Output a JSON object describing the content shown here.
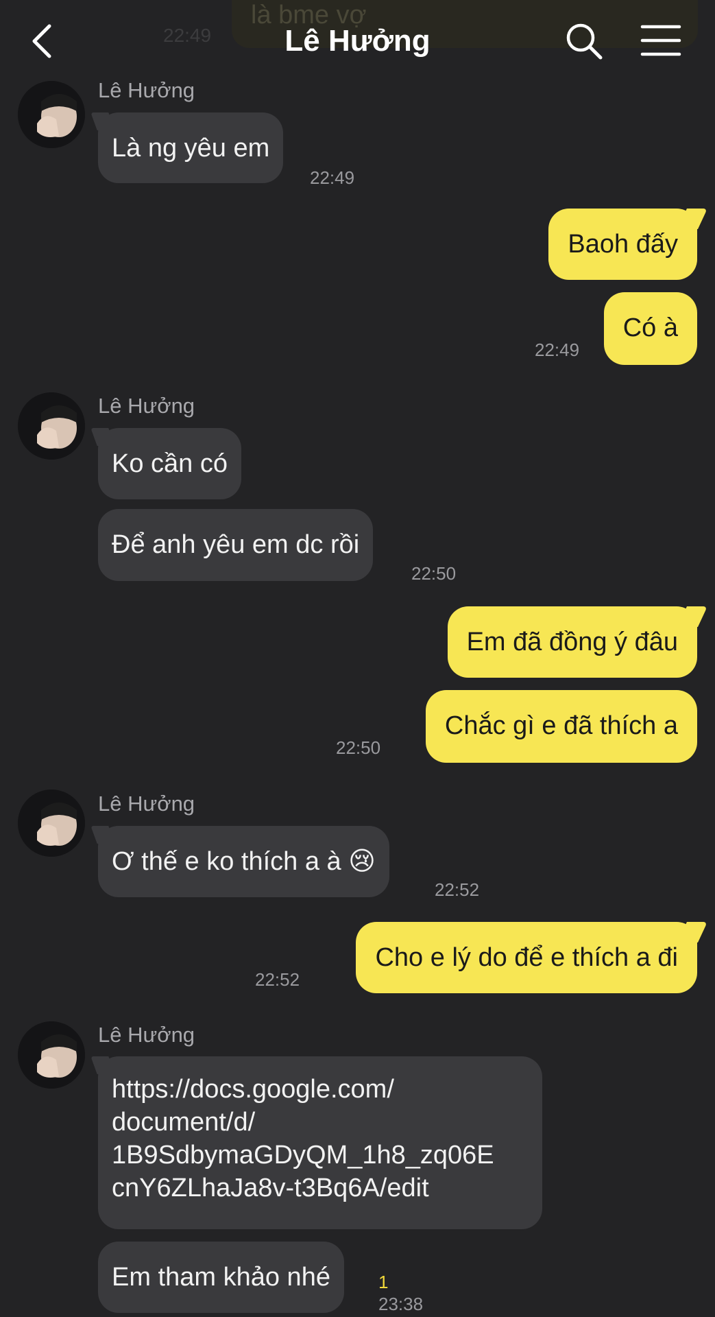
{
  "header": {
    "title": "Lê Hưởng"
  },
  "faded": {
    "text": "là bme vợ",
    "time": "22:49"
  },
  "messages": [
    {
      "sender": "Lê Hưởng",
      "text": "Là ng yêu em",
      "time": "22:49"
    },
    {
      "text": "Baoh đấy"
    },
    {
      "text": "Có à",
      "time": "22:49"
    },
    {
      "sender": "Lê Hưởng",
      "text": "Ko cần có"
    },
    {
      "text": "Để anh yêu em dc rồi",
      "time": "22:50"
    },
    {
      "text": "Em đã đồng ý đâu"
    },
    {
      "text": "Chắc gì e đã thích a",
      "time": "22:50"
    },
    {
      "sender": "Lê Hưởng",
      "text": "Ơ thế e ko thích a à 😢",
      "time": "22:52"
    },
    {
      "text": "Cho e lý do để e thích a đi",
      "time": "22:52"
    },
    {
      "sender": "Lê Hưởng",
      "link_lines": [
        "https://docs.google.com/",
        "document/d/",
        "1B9SdbymaGDyQM_1h8_zq06E",
        "cnY6ZLhaJa8v-t3Bq6A/edit"
      ]
    },
    {
      "text": "Em tham khảo nhé",
      "time": "23:38",
      "unread": "1"
    }
  ],
  "icons": {
    "back": "chevron-left-icon",
    "search": "search-icon",
    "menu": "hamburger-menu-icon",
    "avatar": "avatar-photo"
  },
  "colors": {
    "background": "#232325",
    "incoming_bubble": "#3a3a3d",
    "outgoing_bubble": "#f7e654",
    "unread_count": "#f2d93a"
  }
}
